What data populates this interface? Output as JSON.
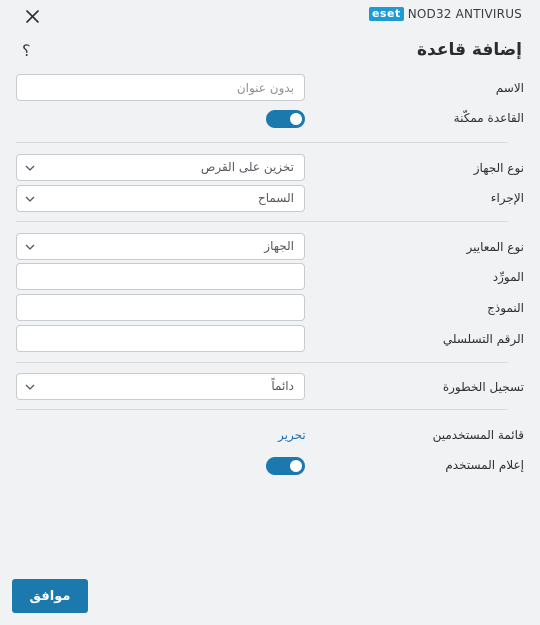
{
  "window": {
    "brand_logo": "eset",
    "product_name": "NOD32 ANTIVIRUS",
    "close_icon": "close-icon",
    "help_glyph": "؟"
  },
  "page": {
    "title": "إضافة قاعدة"
  },
  "form": {
    "name_label": "الاسم",
    "name_value": "",
    "name_placeholder": "بدون عنوان",
    "enabled_label": "القاعدة ممكّنة",
    "enabled_value": true,
    "device_type_label": "نوع الجهاز",
    "device_type_value": "تخزين على القرص",
    "action_label": "الإجراء",
    "action_value": "السماح",
    "criteria_type_label": "نوع المعايير",
    "criteria_type_value": "الجهاز",
    "vendor_label": "المورِّد",
    "vendor_value": "",
    "model_label": "النموذج",
    "model_value": "",
    "serial_label": "الرقم التسلسلي",
    "serial_value": "",
    "severity_label": "تسجيل الخطورة",
    "severity_value": "دائماً",
    "user_list_label": "قائمة المستخدمين",
    "user_list_link": "تحرير",
    "notify_label": "إعلام المستخدم",
    "notify_value": true
  },
  "footer": {
    "ok_label": "موافق"
  },
  "colors": {
    "accent": "#1c79ad",
    "logo": "#1f9bd4",
    "link": "#1a6fb3",
    "background": "#f1f2f4"
  }
}
